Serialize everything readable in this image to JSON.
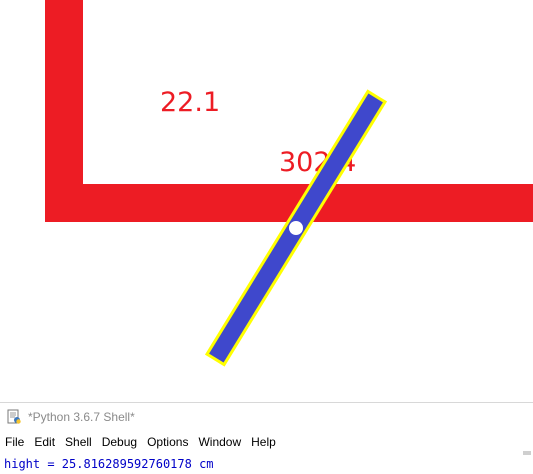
{
  "canvas": {
    "background": "#ffffff",
    "bracket_color": "#ed1c24",
    "bar_fill": "#3f48cc",
    "bar_outline": "#ffff00",
    "pivot_color": "#ffffff",
    "labels": {
      "top_value": "22.1",
      "center_value": "302.4",
      "label_color": "#ed1c24"
    }
  },
  "shell": {
    "window_title": "*Python 3.6.7 Shell*",
    "app_icon": "python-idle-icon",
    "menu": [
      "File",
      "Edit",
      "Shell",
      "Debug",
      "Options",
      "Window",
      "Help"
    ],
    "output_line": "hight = 25.816289592760178 cm",
    "output_color": "#0000c8"
  }
}
